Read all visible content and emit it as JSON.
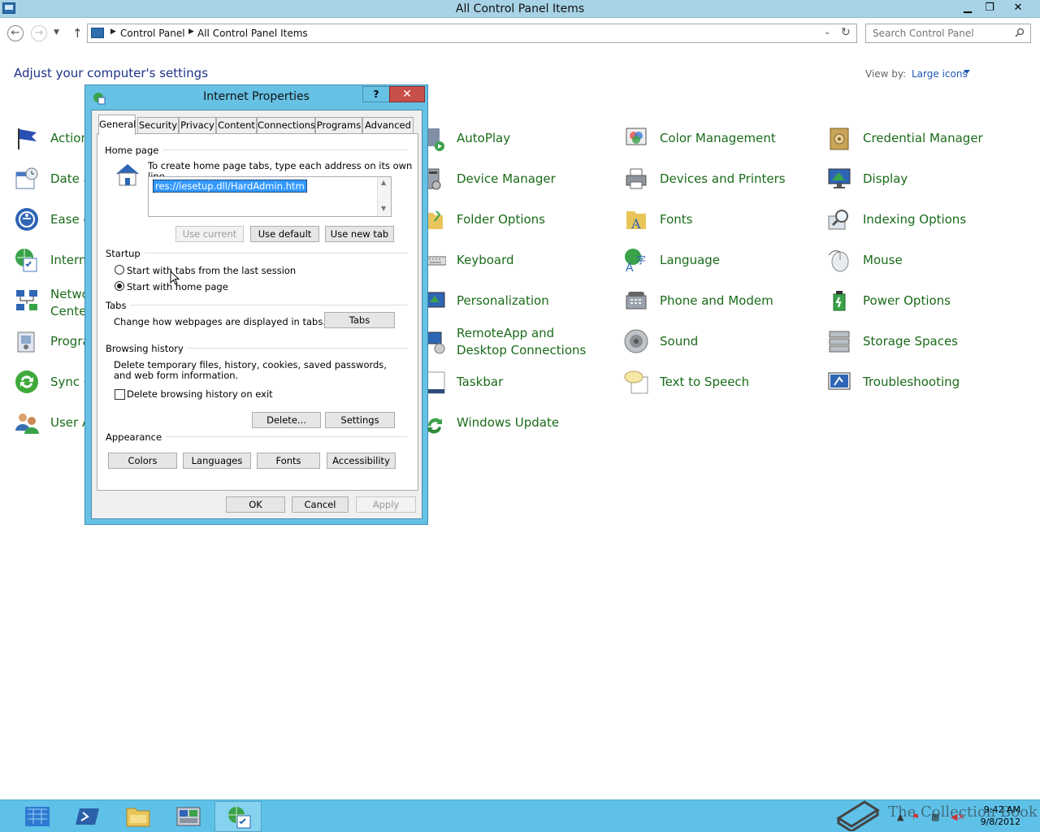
{
  "window": {
    "title": "All Control Panel Items",
    "min": "▁",
    "max": "❐",
    "close": "✕"
  },
  "nav": {
    "breadcrumb": [
      "Control Panel",
      "All Control Panel Items"
    ],
    "search_placeholder": "Search Control Panel"
  },
  "main": {
    "heading": "Adjust your computer's settings",
    "view_by_label": "View by:",
    "view_by_value": "Large icons"
  },
  "items": [
    {
      "label": "Action"
    },
    {
      "label": "Date a"
    },
    {
      "label": "Ease c"
    },
    {
      "label": "Intern"
    },
    {
      "label": "Netwo"
    },
    {
      "label": "Center"
    },
    {
      "label": "Progra"
    },
    {
      "label": "Sync C"
    },
    {
      "label": "User A"
    },
    {
      "label": "AutoPlay"
    },
    {
      "label": "Device Manager"
    },
    {
      "label": "Folder Options"
    },
    {
      "label": "Keyboard"
    },
    {
      "label": "Personalization"
    },
    {
      "label": "RemoteApp and Desktop Connections"
    },
    {
      "label": "Taskbar"
    },
    {
      "label": "Windows Update"
    },
    {
      "label": "Color Management"
    },
    {
      "label": "Devices and Printers"
    },
    {
      "label": "Fonts"
    },
    {
      "label": "Language"
    },
    {
      "label": "Phone and Modem"
    },
    {
      "label": "Sound"
    },
    {
      "label": "Text to Speech"
    },
    {
      "label": "Credential Manager"
    },
    {
      "label": "Display"
    },
    {
      "label": "Indexing Options"
    },
    {
      "label": "Mouse"
    },
    {
      "label": "Power Options"
    },
    {
      "label": "Storage Spaces"
    },
    {
      "label": "Troubleshooting"
    }
  ],
  "dialog": {
    "title": "Internet Properties",
    "help": "?",
    "close": "✕",
    "tabs": [
      "General",
      "Security",
      "Privacy",
      "Content",
      "Connections",
      "Programs",
      "Advanced"
    ],
    "home_page": {
      "group": "Home page",
      "desc": "To create home page tabs, type each address on its own line.",
      "value": "res://iesetup.dll/HardAdmin.htm",
      "use_current": "Use current",
      "use_default": "Use default",
      "use_new_tab": "Use new tab"
    },
    "startup": {
      "group": "Startup",
      "option1": "Start with tabs from the last session",
      "option2": "Start with home page"
    },
    "tabs_group": {
      "group": "Tabs",
      "desc": "Change how webpages are displayed in tabs.",
      "button": "Tabs"
    },
    "history": {
      "group": "Browsing history",
      "desc": "Delete temporary files, history, cookies, saved passwords, and web form information.",
      "checkbox": "Delete browsing history on exit",
      "delete": "Delete...",
      "settings": "Settings"
    },
    "appearance": {
      "group": "Appearance",
      "colors": "Colors",
      "languages": "Languages",
      "fonts": "Fonts",
      "accessibility": "Accessibility"
    },
    "ok": "OK",
    "cancel": "Cancel",
    "apply": "Apply"
  },
  "taskbar": {
    "time": "9:42 AM",
    "date": "9/8/2012",
    "watermark": "The Collection Book"
  }
}
